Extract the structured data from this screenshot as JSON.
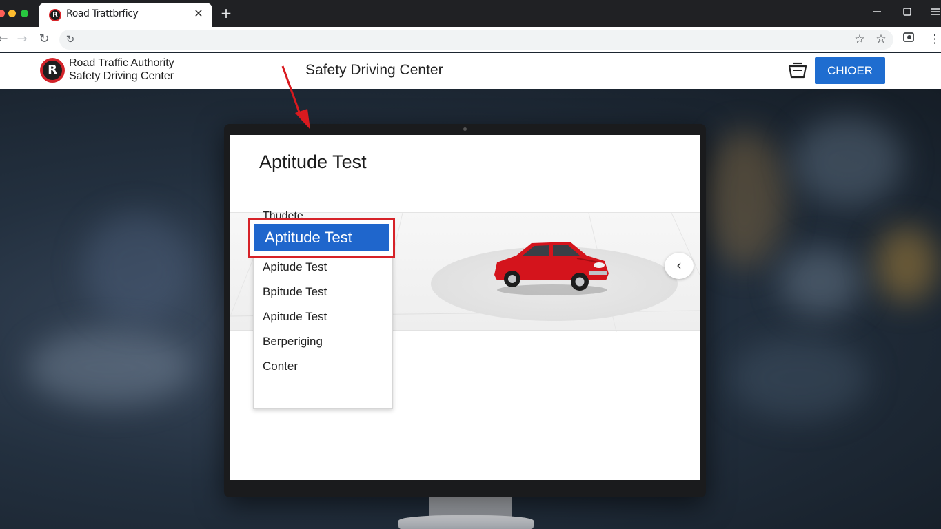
{
  "browser": {
    "tab_title": "Road Trattbrficy",
    "tab_favicon": "R",
    "close_glyph": "✕",
    "new_tab_glyph": "+",
    "window_controls": [
      "minimize-icon",
      "restore-icon",
      "menu-icon"
    ]
  },
  "site": {
    "logo_mark": "R",
    "logo_line1": "Road Traffic Authority",
    "logo_line2": "Safety Driving Center",
    "title": "Safety Driving Center",
    "cta_label": "CHIOER"
  },
  "screen": {
    "heading": "Aptitude Test",
    "dropdown_label": "Thudete",
    "selected_option": "Aptitude Test",
    "options": [
      "Apitude Test",
      "Bpitude Test",
      "Apitude Test",
      "Berperiging",
      "Conter"
    ],
    "carousel_glyph": "‹"
  },
  "colors": {
    "accent": "#1f6dd0",
    "highlight_border": "#d62228",
    "car": "#d4141c"
  }
}
